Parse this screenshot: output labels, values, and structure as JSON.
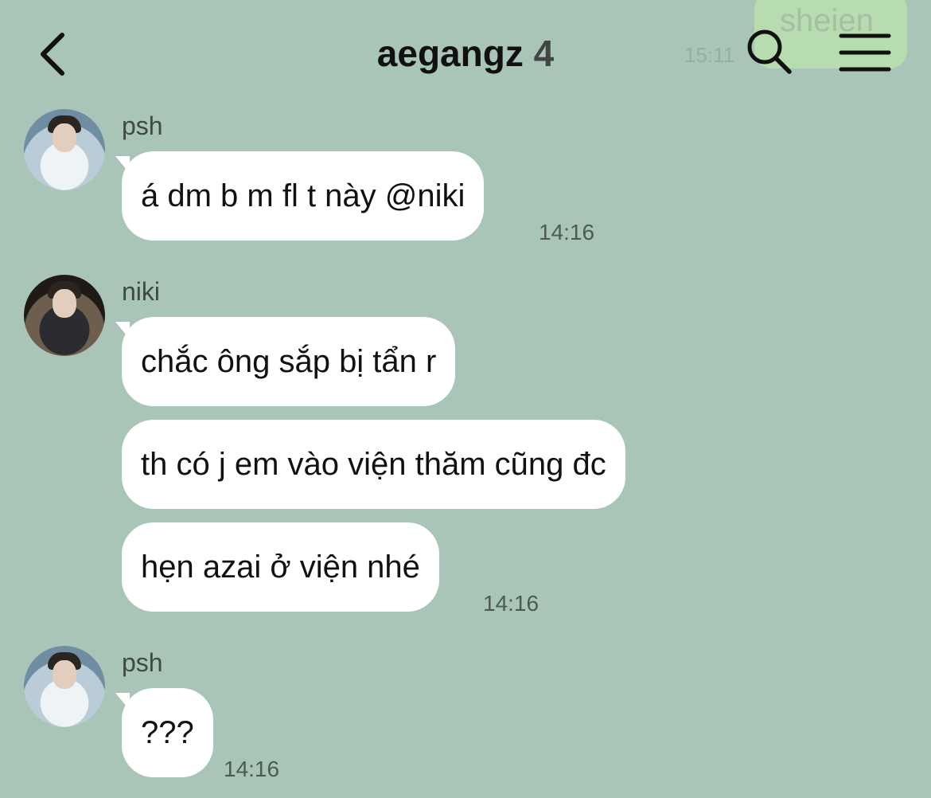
{
  "header": {
    "title": "aegangz",
    "member_count": "4",
    "back_icon": "chevron-left-icon",
    "search_icon": "search-icon",
    "menu_icon": "hamburger-menu-icon"
  },
  "ghost_message": {
    "text": "sheien",
    "time": "15:11"
  },
  "messages": [
    {
      "sender": "psh",
      "bubbles": [
        "á dm b m fl t này @niki"
      ],
      "time": "14:16"
    },
    {
      "sender": "niki",
      "bubbles": [
        "chắc ông sắp bị tẩn r",
        "th có j em vào viện thăm cũng đc",
        "hẹn azai ở viện nhé"
      ],
      "time": "14:16"
    },
    {
      "sender": "psh",
      "bubbles": [
        "???"
      ],
      "time": "14:16"
    }
  ],
  "colors": {
    "background": "#a8c5b7",
    "bubble": "#ffffff",
    "title": "#111111"
  }
}
